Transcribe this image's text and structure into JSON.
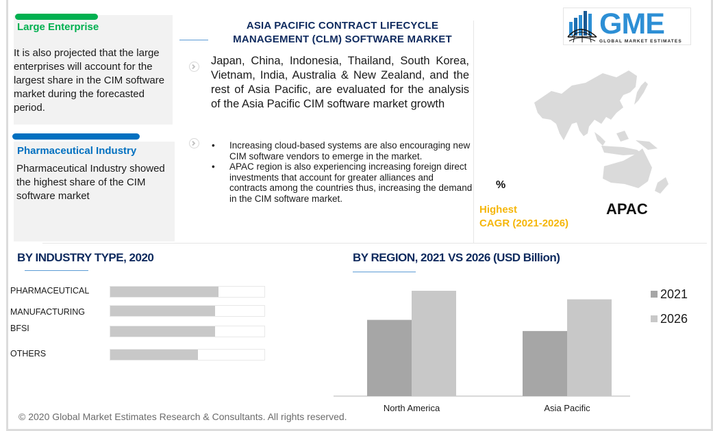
{
  "cards": [
    {
      "title": "Large Enterprise",
      "title_color": "#00b050",
      "accent_color": "#00b050",
      "body": "It is also projected that the large enterprises will account for the largest share in the CIM software market during the forecasted period."
    },
    {
      "title": "Pharmaceutical Industry",
      "title_color": "#0070c0",
      "accent_color": "#0070c0",
      "body": "Pharmaceutical Industry showed the highest share of the CIM software market"
    }
  ],
  "header": {
    "title": "ASIA PACIFIC CONTRACT LIFECYCLE MANAGEMENT (CLM) SOFTWARE MARKET"
  },
  "overview": {
    "paragraph": "Japan, China, Indonesia, Thailand, South Korea, Vietnam, India, Australia & New Zealand, and the rest of Asia Pacific, are evaluated for the analysis of the Asia Pacific CIM software market  growth",
    "bullets": [
      "Increasing cloud-based systems are also encouraging new CIM software vendors to emerge in the market.",
      "APAC region is also experiencing increasing foreign direct investments that account for greater alliances and contracts among the countries thus, increasing the demand in the CIM software market."
    ],
    "icons": [
      "chevron-right-circle-icon",
      "chevron-right-circle-icon"
    ]
  },
  "logo": {
    "main": "GME",
    "sub": "GLOBAL MARKET ESTIMATES",
    "color": "#2d8fd5"
  },
  "highlight": {
    "percent": "%",
    "label_line1": "Highest",
    "label_line2": "CAGR (2021-2026)",
    "region": "APAC",
    "label_color": "#f5b60a",
    "map_icon": "asia-pacific-map"
  },
  "chart_data": [
    {
      "type": "bar",
      "orientation": "horizontal",
      "title": "BY  INDUSTRY TYPE, 2020",
      "categories": [
        "PHARMACEUTICAL",
        "MANUFACTURING",
        "BFSI",
        "OTHERS"
      ],
      "values": [
        70,
        68,
        68,
        57
      ],
      "value_unit": "relative share (% of track)",
      "xlim": [
        0,
        100
      ],
      "grid": false,
      "fill_color": "#c8c8c8"
    },
    {
      "type": "bar",
      "orientation": "vertical",
      "title": "BY  REGION,  2021 VS 2026 (USD Billion)",
      "categories": [
        "North America",
        "Asia Pacific"
      ],
      "series": [
        {
          "name": "2021",
          "values": [
            89,
            76
          ],
          "color": "#a6a6a6"
        },
        {
          "name": "2026",
          "values": [
            123,
            113
          ],
          "color": "#c8c8c8"
        }
      ],
      "value_unit": "relative (no axis labels shown)",
      "ylim": [
        0,
        130
      ],
      "xlabel": "",
      "ylabel": "",
      "grid": false,
      "legend": "right"
    }
  ],
  "footer": {
    "copyright": "© 2020 Global Market Estimates Research & Consultants. All rights reserved."
  }
}
